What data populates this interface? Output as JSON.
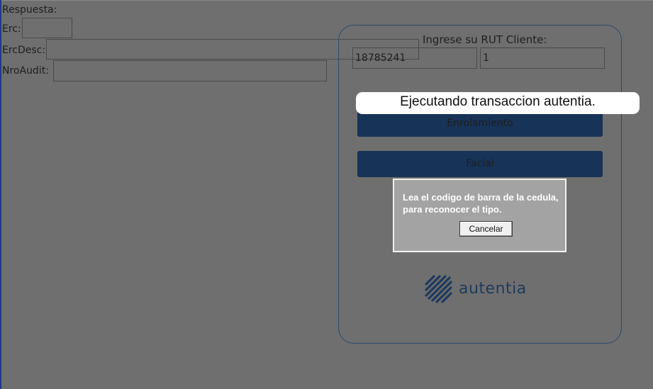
{
  "form": {
    "respuesta_label": "Respuesta:",
    "erc_label": "Erc:",
    "erc_value": "",
    "ercdesc_label": "ErcDesc:",
    "ercdesc_value": "",
    "nroaudit_label": "NroAudit:",
    "nroaudit_value": ""
  },
  "panel": {
    "rut_label": "Ingrese su RUT Cliente:",
    "rut_value": "18785241",
    "dv_value": "1",
    "enrolamiento_label": "Enrolamiento",
    "facial_label": "Facial",
    "logo_text": "autentia"
  },
  "toast": {
    "message": "Ejecutando transaccion autentia."
  },
  "dialog": {
    "message": "Lea el codigo de barra de la cedula, para reconocer el tipo.",
    "cancel_label": "Cancelar"
  },
  "colors": {
    "overlay": "#6f6f6f",
    "button_blue": "#173358",
    "logo_blue": "#1e3a5c",
    "dialog_gray": "#a3a3a3"
  }
}
